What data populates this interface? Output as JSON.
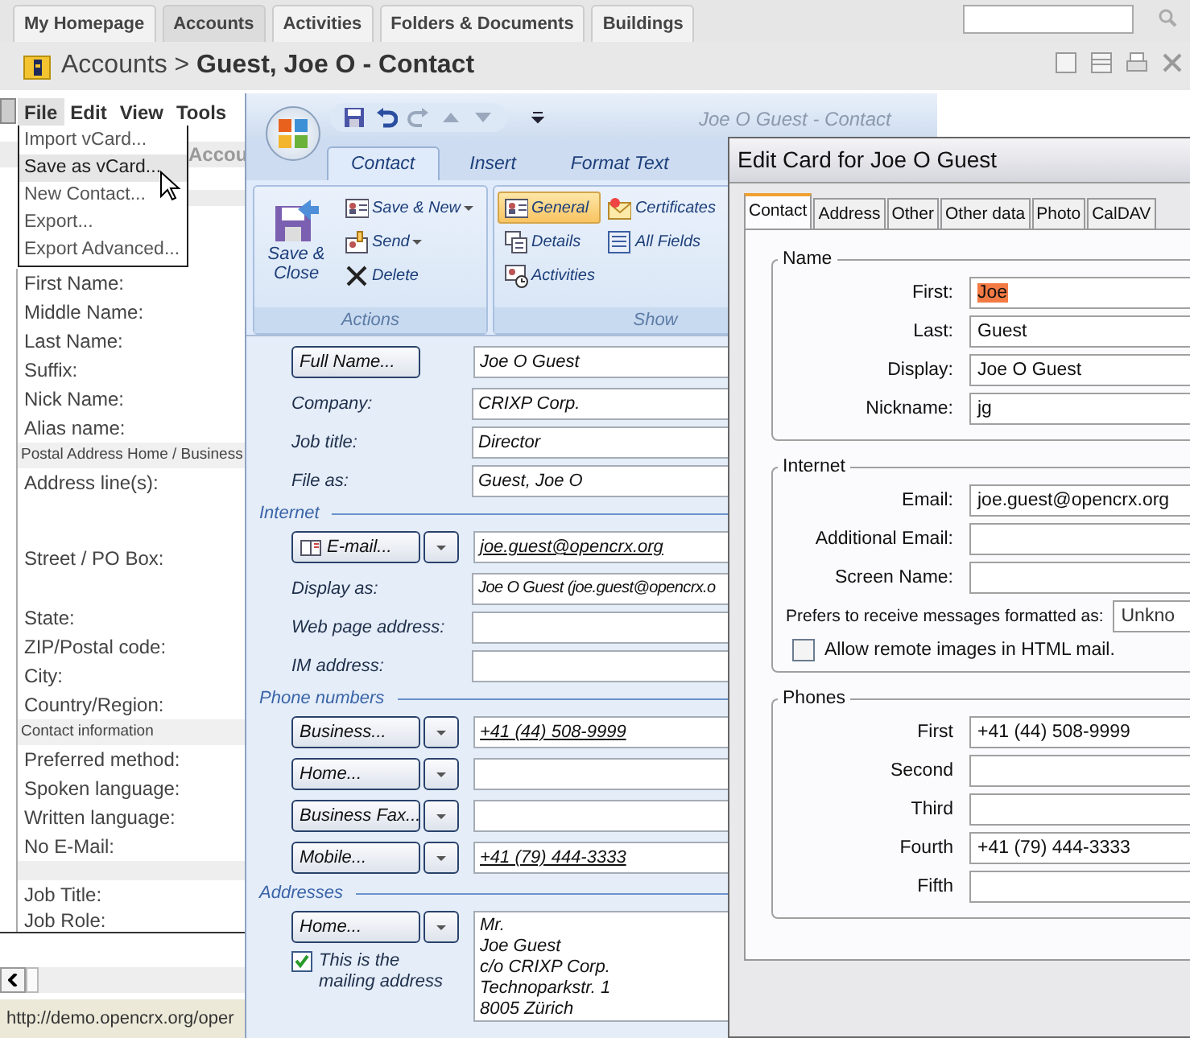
{
  "browser_tabs": [
    {
      "label": "My Homepage",
      "selected": false
    },
    {
      "label": "Accounts",
      "selected": true
    },
    {
      "label": "Activities",
      "selected": false
    },
    {
      "label": "Folders & Documents",
      "selected": false
    },
    {
      "label": "Buildings",
      "selected": false
    }
  ],
  "breadcrumb": {
    "parent": "Accounts",
    "separator": ">",
    "title": "Guest, Joe O - Contact"
  },
  "menu_bar": [
    {
      "label": "File",
      "selected": true
    },
    {
      "label": "Edit",
      "selected": false
    },
    {
      "label": "View",
      "selected": false
    },
    {
      "label": "Tools",
      "selected": false
    }
  ],
  "file_menu": [
    {
      "label": "Import vCard...",
      "selected": false
    },
    {
      "label": "Save as vCard...",
      "selected": true
    },
    {
      "label": "New Contact...",
      "selected": false
    },
    {
      "label": "Export...",
      "selected": false
    },
    {
      "label": "Export Advanced...",
      "selected": false
    }
  ],
  "section_tab": "Accou",
  "form_rows": [
    {
      "kind": "field",
      "label": "First Name:"
    },
    {
      "kind": "field",
      "label": "Middle Name:"
    },
    {
      "kind": "field",
      "label": "Last Name:"
    },
    {
      "kind": "field",
      "label": "Suffix:"
    },
    {
      "kind": "field",
      "label": "Nick Name:"
    },
    {
      "kind": "field",
      "label": "Alias name:"
    },
    {
      "kind": "section",
      "label": "Postal Address Home / Business"
    },
    {
      "kind": "area",
      "label": "Address line(s):"
    },
    {
      "kind": "area2",
      "label": "Street / PO Box:"
    },
    {
      "kind": "field",
      "label": "State:"
    },
    {
      "kind": "field",
      "label": "ZIP/Postal code:"
    },
    {
      "kind": "field",
      "label": "City:"
    },
    {
      "kind": "field",
      "label": "Country/Region:"
    },
    {
      "kind": "section",
      "label": "Contact information"
    },
    {
      "kind": "field",
      "label": "Preferred method:"
    },
    {
      "kind": "field",
      "label": "Spoken language:"
    },
    {
      "kind": "field",
      "label": "Written language:"
    },
    {
      "kind": "field",
      "label": "No E-Mail:"
    },
    {
      "kind": "band"
    },
    {
      "kind": "field",
      "label": "Job Title:"
    },
    {
      "kind": "field",
      "label": "Job Role:"
    }
  ],
  "status_url": "http://demo.opencrx.org/oper",
  "outlook": {
    "title": "Joe O Guest - Contact",
    "ribbon_tabs": [
      {
        "label": "Contact",
        "selected": true
      },
      {
        "label": "Insert",
        "selected": false
      },
      {
        "label": "Format Text",
        "selected": false
      }
    ],
    "actions": {
      "label": "Actions",
      "large": "Save & Close",
      "items": [
        {
          "label": "Save & New",
          "menu": true
        },
        {
          "label": "Send",
          "menu": true
        },
        {
          "label": "Delete",
          "menu": false
        }
      ]
    },
    "show": {
      "label": "Show",
      "items": [
        {
          "label": "General",
          "selected": true
        },
        {
          "label": "Certificates",
          "selected": false
        },
        {
          "label": "Details",
          "selected": false
        },
        {
          "label": "All Fields",
          "selected": false
        },
        {
          "label": "Activities",
          "selected": false
        }
      ]
    },
    "rows": [
      {
        "kind": "button",
        "button": "Full Name...",
        "dropdown": false,
        "value": "Joe O Guest",
        "link": false
      },
      {
        "kind": "label",
        "label": "Company:",
        "value": "CRIXP Corp.",
        "link": false
      },
      {
        "kind": "label",
        "label": "Job title:",
        "value": "Director",
        "link": false
      },
      {
        "kind": "label",
        "label": "File as:",
        "value": "Guest, Joe O",
        "link": false
      },
      {
        "kind": "heading",
        "label": "Internet"
      },
      {
        "kind": "mail",
        "button": "E-mail...",
        "dropdown": true,
        "value": "joe.guest@opencrx.org",
        "link": true
      },
      {
        "kind": "label",
        "label": "Display as:",
        "value": "Joe O Guest (joe.guest@opencrx.o",
        "link": false
      },
      {
        "kind": "label",
        "label": "Web page address:"
      },
      {
        "kind": "label",
        "label": "IM address:"
      },
      {
        "kind": "heading",
        "label": "Phone numbers"
      },
      {
        "kind": "button",
        "button": "Business...",
        "dropdown": true,
        "value": "+41 (44) 508-9999",
        "link": true
      },
      {
        "kind": "button",
        "button": "Home...",
        "dropdown": true
      },
      {
        "kind": "button",
        "button": "Business Fax...",
        "dropdown": true
      },
      {
        "kind": "button",
        "button": "Mobile...",
        "dropdown": true,
        "value": "+41 (79) 444-3333",
        "link": true
      },
      {
        "kind": "heading",
        "label": "Addresses"
      },
      {
        "kind": "address",
        "button": "Home...",
        "dropdown": true,
        "mailing": {
          "label": "This is the mailing address",
          "checked": true
        },
        "lines": [
          "Mr.",
          "Joe Guest",
          "c/o CRIXP Corp.",
          "Technoparkstr. 1",
          "8005  Zürich"
        ]
      }
    ]
  },
  "edit_card": {
    "title": "Edit Card for Joe O Guest",
    "tabs": [
      {
        "label": "Contact",
        "selected": true
      },
      {
        "label": "Address",
        "selected": false
      },
      {
        "label": "Other",
        "selected": false
      },
      {
        "label": "Other data",
        "selected": false
      },
      {
        "label": "Photo",
        "selected": false
      },
      {
        "label": "CalDAV",
        "selected": false
      }
    ],
    "groups": [
      {
        "legend": "Name",
        "rows": [
          {
            "label": "First:",
            "value": "Joe",
            "text_selected": true
          },
          {
            "label": "Last:",
            "value": "Guest",
            "text_selected": false
          },
          {
            "label": "Display:",
            "value": "Joe O Guest",
            "text_selected": false
          },
          {
            "label": "Nickname:",
            "value": "jg",
            "text_selected": false
          }
        ]
      },
      {
        "legend": "Internet",
        "rows": [
          {
            "label": "Email:",
            "value": "joe.guest@opencrx.org",
            "text_selected": false
          },
          {
            "label": "Additional Email:"
          },
          {
            "label": "Screen Name:"
          }
        ],
        "format": {
          "label": "Prefers to receive messages formatted as:",
          "value": "Unkno"
        },
        "remote_images": {
          "label": "Allow remote images in HTML mail.",
          "checked": false
        }
      },
      {
        "legend": "Phones",
        "rows": [
          {
            "label": "First",
            "value": "+41 (44) 508-9999",
            "text_selected": false
          },
          {
            "label": "Second"
          },
          {
            "label": "Third"
          },
          {
            "label": "Fourth",
            "value": "+41 (79) 444-3333",
            "text_selected": false
          },
          {
            "label": "Fifth"
          }
        ]
      }
    ]
  }
}
